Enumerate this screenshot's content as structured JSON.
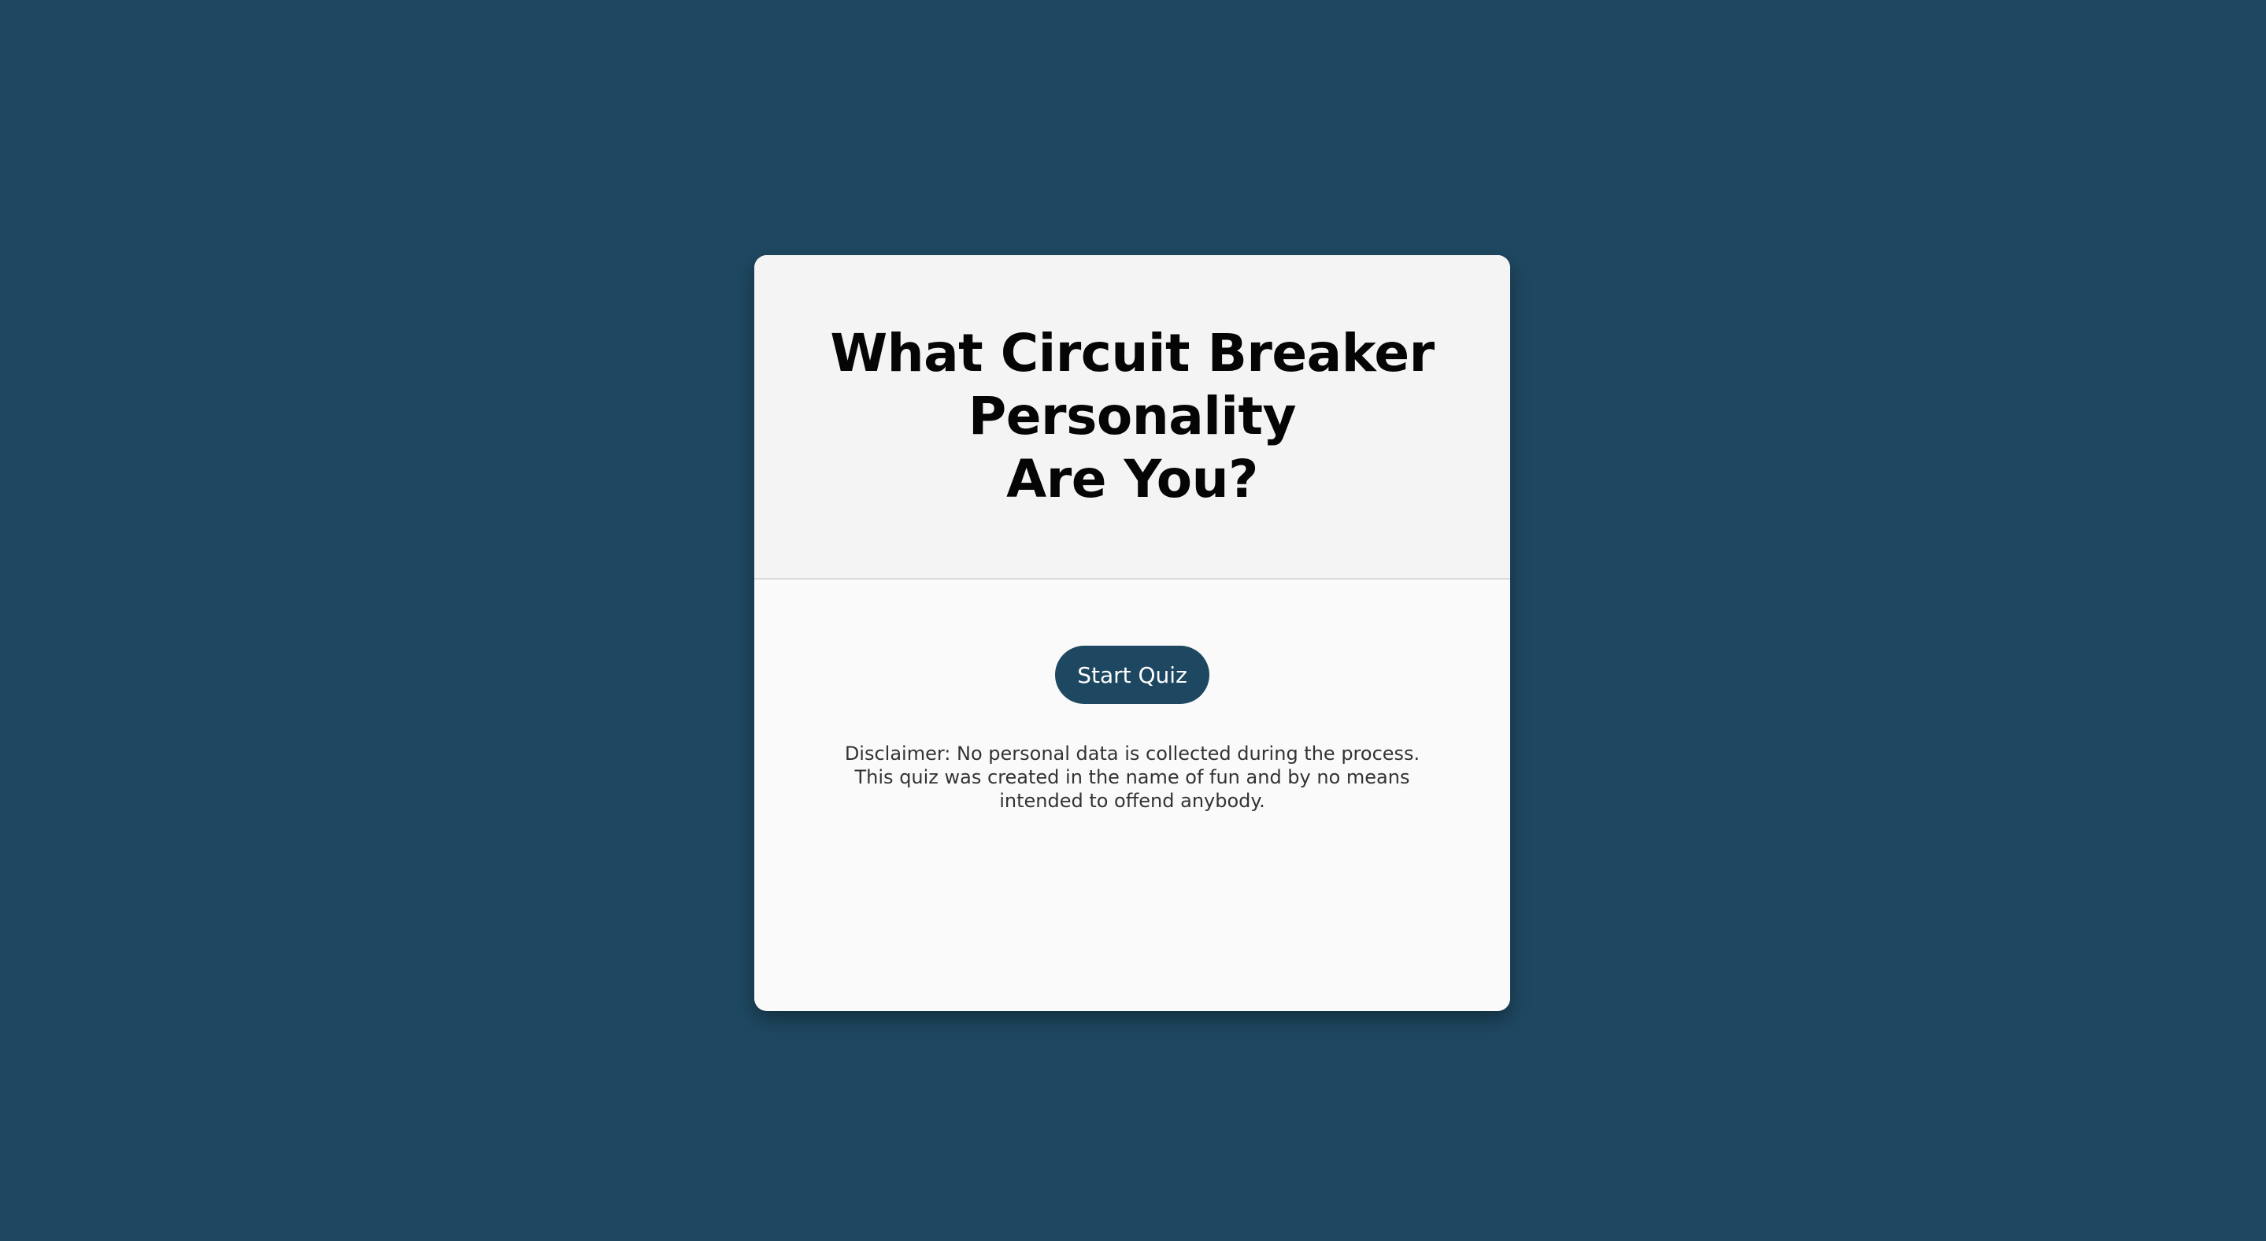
{
  "quiz": {
    "title_lines": [
      "What Circuit Breaker",
      "Personality",
      "Are You?"
    ],
    "start_label": "Start Quiz",
    "disclaimer_lines": [
      "Disclaimer: No personal data is collected during the process.",
      "This quiz was created in the name of fun and by no means",
      "intended to offend anybody."
    ]
  },
  "colors": {
    "background": "#1e4861",
    "button": "#1e4861",
    "card_header": "#f4f4f4",
    "card_body": "#fafafa"
  }
}
